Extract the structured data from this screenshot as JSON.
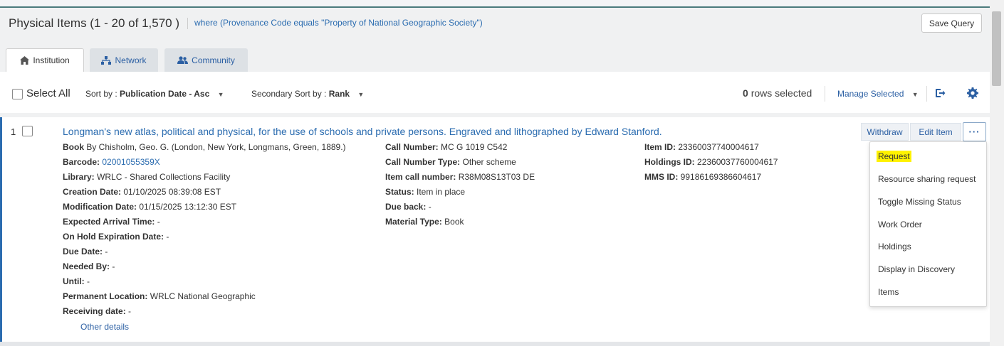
{
  "header": {
    "title": "Physical Items (1 - 20 of 1,570 )",
    "query": "where (Provenance Code equals \"Property of National Geographic Society\")",
    "save_query_label": "Save Query"
  },
  "tabs": [
    {
      "label": "Institution",
      "icon": "home-icon"
    },
    {
      "label": "Network",
      "icon": "network-icon"
    },
    {
      "label": "Community",
      "icon": "users-icon"
    }
  ],
  "toolbar": {
    "select_all_label": "Select All",
    "sort_by_label": "Sort by :",
    "sort_by_value": "Publication Date - Asc",
    "secondary_sort_label": "Secondary Sort by :",
    "secondary_sort_value": "Rank",
    "rows_selected_count": "0",
    "rows_selected_text": "rows selected",
    "manage_selected_label": "Manage Selected"
  },
  "item": {
    "number": "1",
    "title": "Longman's new atlas, political and physical, for the use of schools and private persons. Engraved and lithographed by Edward Stanford.",
    "col1": [
      {
        "label": "Book",
        "value": "By Chisholm, Geo. G. (London, New York, Longmans, Green, 1889.)"
      },
      {
        "label": "Barcode:",
        "value": "02001055359X"
      },
      {
        "label": "Library:",
        "value": "WRLC - Shared Collections Facility"
      },
      {
        "label": "Creation Date:",
        "value": "01/10/2025 08:39:08 EST"
      },
      {
        "label": "Modification Date:",
        "value": "01/15/2025 13:12:30 EST"
      },
      {
        "label": "Expected Arrival Time:",
        "value": "-"
      },
      {
        "label": "On Hold Expiration Date:",
        "value": "-"
      },
      {
        "label": "Due Date:",
        "value": "-"
      },
      {
        "label": "Needed By:",
        "value": "-"
      },
      {
        "label": "Until:",
        "value": "-"
      },
      {
        "label": "Permanent Location:",
        "value": "WRLC National Geographic"
      },
      {
        "label": "Receiving date:",
        "value": "-"
      }
    ],
    "col2": [
      {
        "label": "Call Number:",
        "value": "MC G 1019 C542"
      },
      {
        "label": "Call Number Type:",
        "value": "Other scheme"
      },
      {
        "label": "Item call number:",
        "value": "R38M08S13T03 DE"
      },
      {
        "label": "Status:",
        "value": "Item in place"
      },
      {
        "label": "Due back:",
        "value": "-"
      },
      {
        "label": "Material Type:",
        "value": "Book"
      }
    ],
    "col3": [
      {
        "label": "Item ID:",
        "value": "23360037740004617"
      },
      {
        "label": "Holdings ID:",
        "value": "22360037760004617"
      },
      {
        "label": "MMS ID:",
        "value": "99186169386604617"
      }
    ],
    "other_details_label": "Other details",
    "actions": {
      "withdraw": "Withdraw",
      "edit_item": "Edit Item",
      "more": "···"
    }
  },
  "menu": {
    "items": [
      "Request",
      "Resource sharing request",
      "Toggle Missing Status",
      "Work Order",
      "Holdings",
      "Display in Discovery",
      "Items"
    ],
    "highlighted": "Request"
  },
  "colors": {
    "link": "#2b6cb0",
    "accent_bar": "#2b6cb0",
    "highlight": "#fff200",
    "top_border": "#4a7a7c"
  }
}
